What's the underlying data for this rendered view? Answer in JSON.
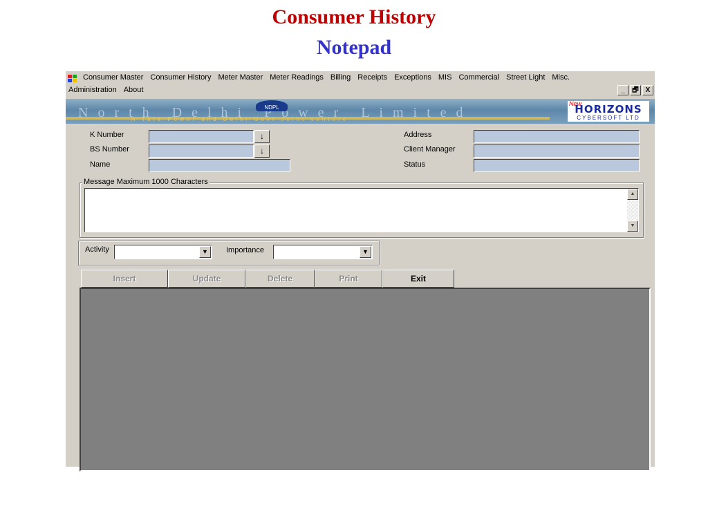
{
  "slide": {
    "title": "Consumer History",
    "subtitle": "Notepad"
  },
  "menu": {
    "row1": [
      "Consumer Master",
      "Consumer History",
      "Meter Master",
      "Meter Readings",
      "Billing",
      "Receipts",
      "Exceptions",
      "MIS",
      "Commercial",
      "Street Light",
      "Misc."
    ],
    "row2": [
      "Administration",
      "About"
    ]
  },
  "window_controls": {
    "minimize": "_",
    "restore": "🗗",
    "close": "X"
  },
  "banner": {
    "text": "North Delhi Power Limited",
    "subtext": "A Tata Power and Delhi Govt Joint venture",
    "logo_text": "NDPL",
    "partner_new": "New",
    "partner_name": "HORIZONS",
    "partner_sub": "CYBERSOFT LTD"
  },
  "form": {
    "k_number_label": "K Number",
    "k_number_value": "",
    "bs_number_label": "BS Number",
    "bs_number_value": "",
    "name_label": "Name",
    "name_value": "",
    "address_label": "Address",
    "address_value": "",
    "client_manager_label": "Client Manager",
    "client_manager_value": "",
    "status_label": "Status",
    "status_value": "",
    "lookup_glyph": "↓"
  },
  "message": {
    "label": "Message Maximum 1000 Characters",
    "value": ""
  },
  "activity": {
    "label": "Activity",
    "value": ""
  },
  "importance": {
    "label": "Importance",
    "value": ""
  },
  "buttons": {
    "insert": "Insert",
    "update": "Update",
    "delete": "Delete",
    "print": "Print",
    "exit": "Exit"
  },
  "colors": {
    "title": "#c00000",
    "subtitle": "#3333cc",
    "window": "#d4d0c8",
    "field": "#b9c8dc",
    "grid": "#808080"
  }
}
